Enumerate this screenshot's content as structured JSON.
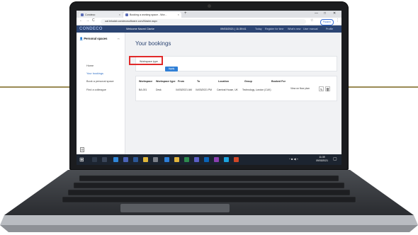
{
  "browser": {
    "tabs": [
      {
        "label": "Condeco"
      },
      {
        "label": "Booking a working space - Wor..."
      }
    ],
    "new_tab": "+",
    "window_controls": [
      "—",
      "□",
      "✕"
    ],
    "nav": {
      "back": "←",
      "forward": "→",
      "reload": "C"
    },
    "url": "uat.tekalab.condecosoftware.com/Master.aspx",
    "profile_status": "Paused"
  },
  "app": {
    "logo": "CONDECO",
    "welcome": "Welcome Naomi Clarke",
    "datetime": "09/03/2021 | 11:39:41",
    "nav": [
      "Today",
      "Register for time",
      "What's new",
      "User manual",
      "Profile"
    ],
    "brand_color": "#2c4573"
  },
  "sidebar": {
    "heading": "Personal spaces",
    "collapse": "‹‹",
    "items": [
      {
        "label": "Home"
      },
      {
        "label": "Your bookings",
        "active": true
      },
      {
        "label": "Book a personal space"
      },
      {
        "label": "Find a colleague"
      }
    ]
  },
  "main": {
    "title": "Your bookings",
    "filter": {
      "workspace_type_label": "Workspace type",
      "apply_label": "Apply"
    },
    "table": {
      "headers": [
        "Workspace",
        "Workspace type",
        "From",
        "To",
        "Location",
        "Group",
        "Booked For"
      ],
      "rows": [
        [
          "BA-001",
          "Desk",
          "04/03/2021 AM",
          "04/03/2021 PM",
          "Carnival House, UK",
          "Technology, London (CUK)",
          ""
        ]
      ],
      "row_action": "View on floor plan",
      "edit_icon": "pencil-icon",
      "delete_icon": "trash-icon"
    }
  },
  "taskbar": {
    "clock_time": "11:39",
    "clock_date": "09/03/2021"
  },
  "highlight_color": "#e12a2a",
  "accent_color": "#2f7fd6"
}
